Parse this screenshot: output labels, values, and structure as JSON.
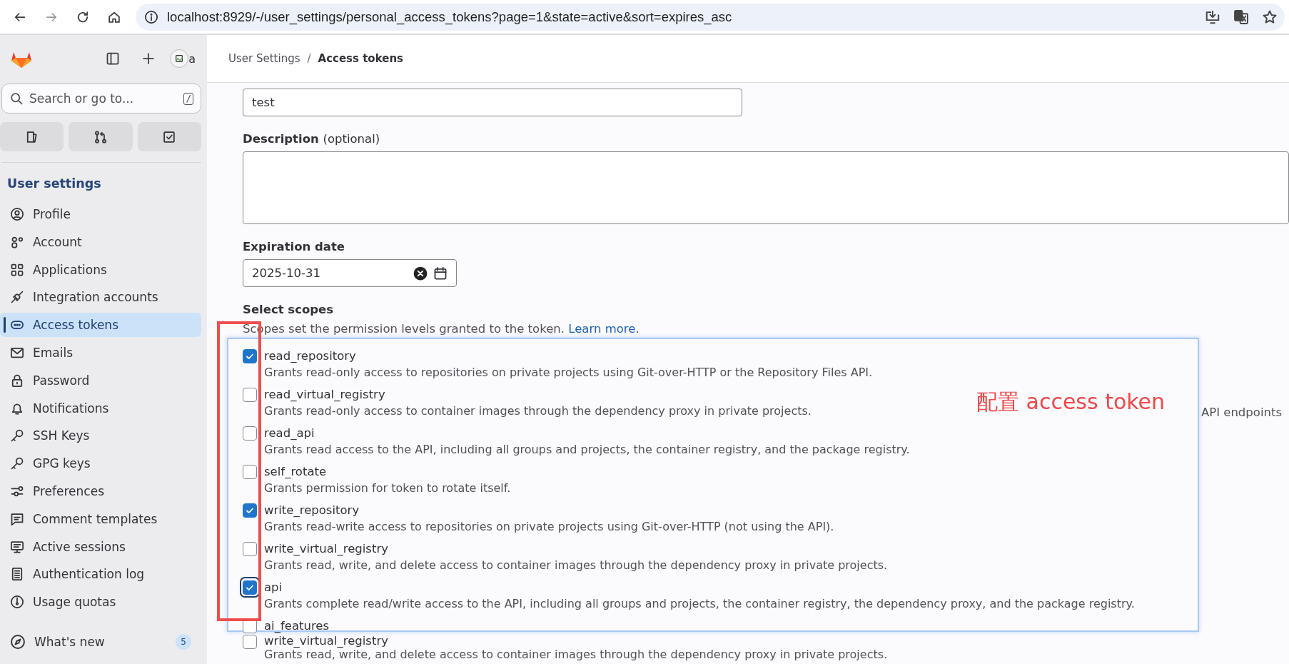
{
  "browser": {
    "url": "localhost:8929/-/user_settings/personal_access_tokens?page=1&state=active&sort=expires_asc"
  },
  "sidebar": {
    "avatar_alt": "a",
    "search": {
      "placeholder": "Search or go to...",
      "shortcut": "/"
    },
    "section_title": "User settings",
    "items": [
      {
        "label": "Profile",
        "selected": false
      },
      {
        "label": "Account",
        "selected": false
      },
      {
        "label": "Applications",
        "selected": false
      },
      {
        "label": "Integration accounts",
        "selected": false
      },
      {
        "label": "Access tokens",
        "selected": true
      },
      {
        "label": "Emails",
        "selected": false
      },
      {
        "label": "Password",
        "selected": false
      },
      {
        "label": "Notifications",
        "selected": false
      },
      {
        "label": "SSH Keys",
        "selected": false
      },
      {
        "label": "GPG keys",
        "selected": false
      },
      {
        "label": "Preferences",
        "selected": false
      },
      {
        "label": "Comment templates",
        "selected": false
      },
      {
        "label": "Active sessions",
        "selected": false
      },
      {
        "label": "Authentication log",
        "selected": false
      },
      {
        "label": "Usage quotas",
        "selected": false
      }
    ],
    "whats_new": {
      "label": "What's new",
      "badge": "5"
    }
  },
  "breadcrumb": [
    "User Settings",
    "Access tokens"
  ],
  "breadcrumb_separator": "/",
  "form": {
    "name_value": "test",
    "description_label": "Description",
    "description_optional": "(optional)",
    "expiration_label": "Expiration date",
    "expiration_value": "2025-10-31",
    "scopes_label": "Select scopes",
    "scopes_help": "Scopes set the permission levels granted to the token.",
    "scopes_link": "Learn more",
    "scopes_help_end": ".",
    "partial_text": "API endpoints",
    "partial_scope": {
      "name": "write_virtual_registry",
      "description": "Grants read, write, and delete access to container images through the dependency proxy in private projects.",
      "checked": false
    }
  },
  "overlay": {
    "annotation": "配置 access token",
    "scopes": [
      {
        "name": "read_repository",
        "description": "Grants read-only access to repositories on private projects using Git-over-HTTP or the Repository Files API.",
        "checked": true,
        "focused": false
      },
      {
        "name": "read_virtual_registry",
        "description": "Grants read-only access to container images through the dependency proxy in private projects.",
        "checked": false,
        "focused": false
      },
      {
        "name": "read_api",
        "description": "Grants read access to the API, including all groups and projects, the container registry, and the package registry.",
        "checked": false,
        "focused": false
      },
      {
        "name": "self_rotate",
        "description": "Grants permission for token to rotate itself.",
        "checked": false,
        "focused": false
      },
      {
        "name": "write_repository",
        "description": "Grants read-write access to repositories on private projects using Git-over-HTTP (not using the API).",
        "checked": true,
        "focused": false
      },
      {
        "name": "write_virtual_registry",
        "description": "Grants read, write, and delete access to container images through the dependency proxy in private projects.",
        "checked": false,
        "focused": false
      },
      {
        "name": "api",
        "description": "Grants complete read/write access to the API, including all groups and projects, the container registry, the dependency proxy, and the package registry.",
        "checked": true,
        "focused": true
      },
      {
        "name": "ai_features",
        "checked": false,
        "focused": false
      }
    ]
  }
}
